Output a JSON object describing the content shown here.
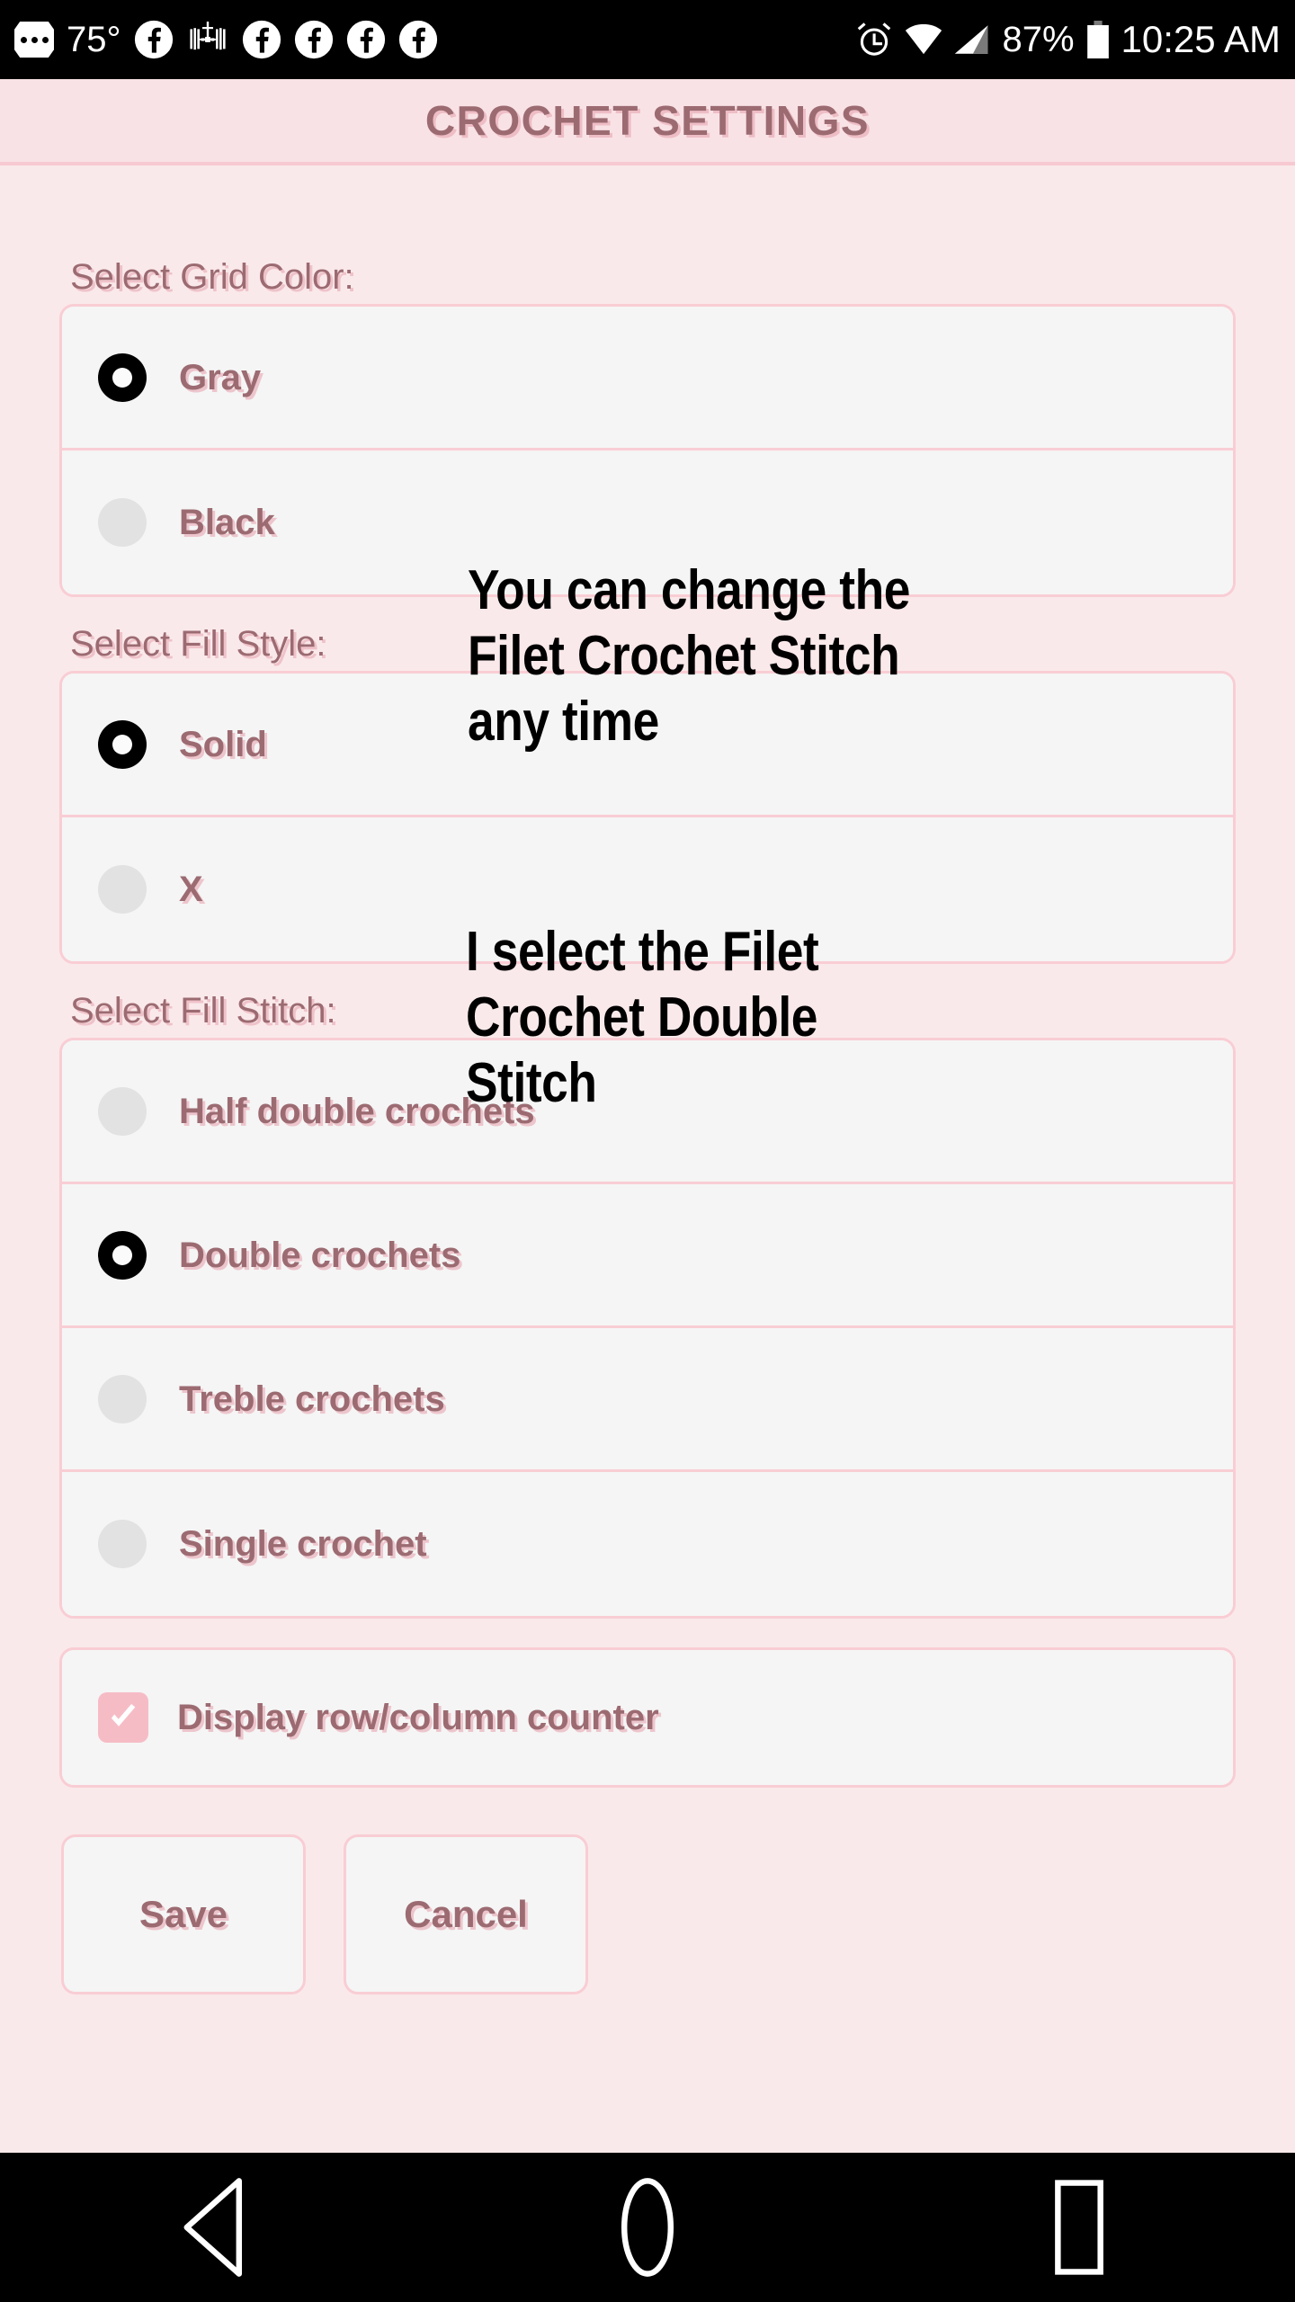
{
  "status_bar": {
    "temperature": "75°",
    "battery_percent": "87%",
    "time": "10:25 AM",
    "left_icons": [
      "more-dots-badge-icon",
      "facebook-icon",
      "space-station-icon",
      "facebook-icon",
      "facebook-icon",
      "facebook-icon",
      "facebook-icon"
    ],
    "right_icons": [
      "alarm-clock-icon",
      "wifi-icon",
      "cellular-signal-icon",
      "battery-icon"
    ]
  },
  "header": {
    "title": "CROCHET SETTINGS"
  },
  "sections": {
    "grid_color": {
      "label": "Select Grid Color:",
      "options": [
        {
          "label": "Gray",
          "selected": true
        },
        {
          "label": "Black",
          "selected": false
        }
      ]
    },
    "fill_style": {
      "label": "Select Fill Style:",
      "options": [
        {
          "label": "Solid",
          "selected": true
        },
        {
          "label": "X",
          "selected": false
        }
      ]
    },
    "fill_stitch": {
      "label": "Select Fill Stitch:",
      "options": [
        {
          "label": "Half double crochets",
          "selected": false
        },
        {
          "label": "Double crochets",
          "selected": true
        },
        {
          "label": "Treble crochets",
          "selected": false
        },
        {
          "label": "Single crochet",
          "selected": false
        }
      ]
    }
  },
  "counter_checkbox": {
    "label": "Display row/column counter",
    "checked": true
  },
  "buttons": {
    "save": "Save",
    "cancel": "Cancel"
  },
  "annotations": [
    {
      "text": "You can change the\nFilet Crochet Stitch\nany time"
    },
    {
      "text": "I select the Filet\nCrochet Double\nStitch"
    }
  ],
  "nav_bar": {
    "back": "back-triangle-icon",
    "home": "home-circle-icon",
    "recents": "recents-square-icon"
  },
  "colors": {
    "page_bg": "#fae9ea",
    "header_bg": "#f9e2e5",
    "card_bg": "#f5f5f5",
    "border_pink": "#f9cdd4",
    "text_mauve": "#9c6b72",
    "text_shadow_pink": "#e9b0ba",
    "checkbox_pink": "#f6bcc6",
    "radio_off_gray": "#e2e2e2",
    "status_bar_bg": "#000000"
  }
}
